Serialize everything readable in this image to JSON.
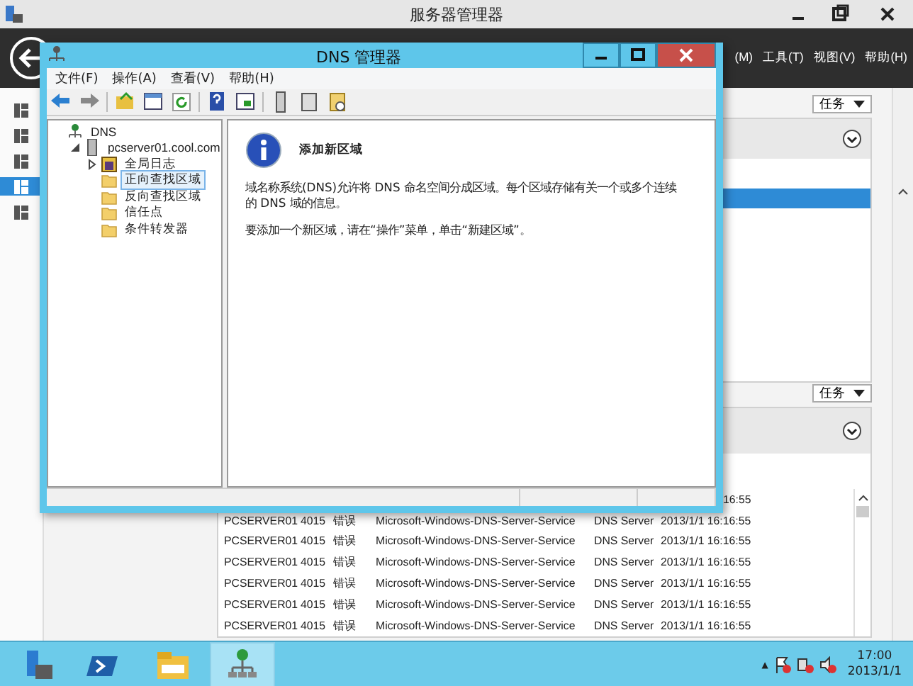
{
  "server_manager": {
    "title": "服务器管理器",
    "menus": [
      "(M)",
      "工具(T)",
      "视图(V)",
      "帮助(H)"
    ],
    "nav_items": [
      {
        "selected": false
      },
      {
        "selected": false
      },
      {
        "selected": false
      },
      {
        "selected": true
      },
      {
        "selected": false
      }
    ],
    "upper_panel": {
      "tasks": "任务",
      "rows": [
        {
          "selected": true
        }
      ]
    },
    "events_panel": {
      "tasks": "任务",
      "rows": [
        {
          "kind": "partial",
          "cells": [
            "",
            "",
            "",
            "",
            "",
            "16:55"
          ]
        },
        {
          "kind": "full",
          "cells": [
            "PCSERVER01",
            "4015",
            "错误",
            "Microsoft-Windows-DNS-Server-Service",
            "DNS Server",
            "2013/1/1 16:16:55"
          ]
        },
        {
          "kind": "full",
          "cells": [
            "PCSERVER01",
            "4015",
            "错误",
            "Microsoft-Windows-DNS-Server-Service",
            "DNS Server",
            "2013/1/1 16:16:55"
          ]
        },
        {
          "kind": "full",
          "cells": [
            "PCSERVER01",
            "4015",
            "错误",
            "Microsoft-Windows-DNS-Server-Service",
            "DNS Server",
            "2013/1/1 16:16:55"
          ]
        },
        {
          "kind": "full",
          "cells": [
            "PCSERVER01",
            "4015",
            "错误",
            "Microsoft-Windows-DNS-Server-Service",
            "DNS Server",
            "2013/1/1 16:16:55"
          ]
        },
        {
          "kind": "full",
          "cells": [
            "PCSERVER01",
            "4015",
            "错误",
            "Microsoft-Windows-DNS-Server-Service",
            "DNS Server",
            "2013/1/1 16:16:55"
          ]
        },
        {
          "kind": "full",
          "cells": [
            "PCSERVER01",
            "4015",
            "错误",
            "Microsoft-Windows-DNS-Server-Service",
            "DNS Server",
            "2013/1/1 16:16:55"
          ]
        }
      ]
    }
  },
  "dns_window": {
    "title": "DNS 管理器",
    "menus": [
      "文件(F)",
      "操作(A)",
      "查看(V)",
      "帮助(H)"
    ],
    "tree": [
      {
        "label": "DNS",
        "kind": "root",
        "selected": false,
        "children": [
          {
            "label": "pcserver01.cool.com",
            "kind": "server",
            "selected": false,
            "expanded": true,
            "children": [
              {
                "label": "全局日志",
                "kind": "log",
                "selected": false,
                "expanded": false
              },
              {
                "label": "正向查找区域",
                "kind": "folder",
                "selected": true
              },
              {
                "label": "反向查找区域",
                "kind": "folder",
                "selected": false
              },
              {
                "label": "信任点",
                "kind": "folder",
                "selected": false
              },
              {
                "label": "条件转发器",
                "kind": "folder",
                "selected": false
              }
            ]
          }
        ]
      }
    ],
    "detail": {
      "heading": "添加新区域",
      "paragraphs": [
        "域名称系统(DNS)允许将 DNS 命名空间分成区域。每个区域存储有关一个或多个连续的 DNS 域的信息。",
        "要添加一个新区域，请在“操作”菜单，单击“新建区域”。"
      ]
    }
  },
  "taskbar": {
    "apps": [
      {
        "selected": false
      },
      {
        "selected": false
      },
      {
        "selected": false
      },
      {
        "selected": true
      }
    ],
    "tray_arrow": "▲",
    "time": "17:00",
    "date": "2013/1/1"
  }
}
